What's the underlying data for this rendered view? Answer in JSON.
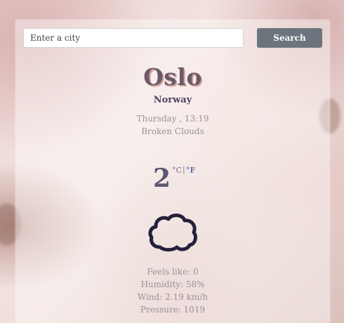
{
  "search": {
    "placeholder": "Enter a city",
    "value": "",
    "button_label": "Search"
  },
  "location": {
    "city": "Oslo",
    "country": "Norway"
  },
  "conditions": {
    "datetime": "Thursday , 13:19",
    "description": "Broken Clouds",
    "temperature": "2",
    "unit_celsius": "°C",
    "unit_separator": "|",
    "unit_fahrenheit": "°F",
    "icon": "cloud-icon"
  },
  "details": {
    "feels_like": "Feels like: 0",
    "humidity": "Humidity: 58%",
    "wind": "Wind: 2.19 km/h",
    "pressure": "Pressure: 1019"
  },
  "colors": {
    "button_bg": "#6c757d",
    "city_text": "#6b5a67",
    "city_shadow": "#d69f9f",
    "icon_stroke": "#23203b",
    "fahrenheit_link": "#5b6fa6"
  }
}
